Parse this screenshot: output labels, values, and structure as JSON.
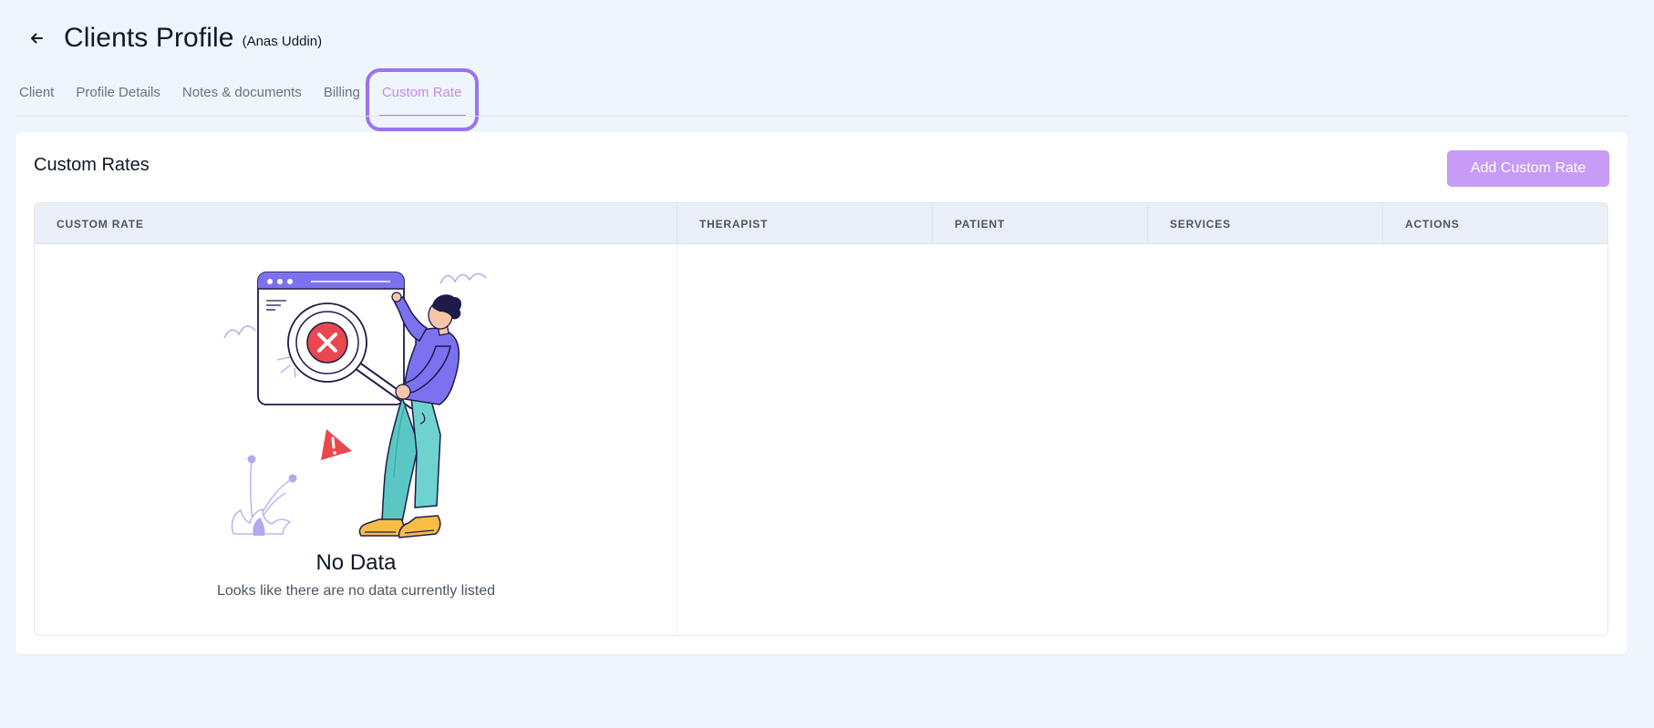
{
  "header": {
    "title": "Clients Profile",
    "client_name": "(Anas Uddin)"
  },
  "tabs": [
    {
      "label": "Client"
    },
    {
      "label": "Profile Details"
    },
    {
      "label": "Notes & documents"
    },
    {
      "label": "Billing"
    },
    {
      "label": "Custom Rate",
      "active": true
    }
  ],
  "section": {
    "title": "Custom Rates",
    "add_button": "Add Custom Rate"
  },
  "table": {
    "columns": [
      "CUSTOM RATE",
      "THERAPIST",
      "PATIENT",
      "SERVICES",
      "ACTIONS"
    ],
    "rows": []
  },
  "empty_state": {
    "title": "No Data",
    "description": "Looks like there are no data currently listed"
  },
  "colors": {
    "accent": "#c79bf6",
    "highlight": "#9b73f2",
    "background": "#eef5fd"
  }
}
